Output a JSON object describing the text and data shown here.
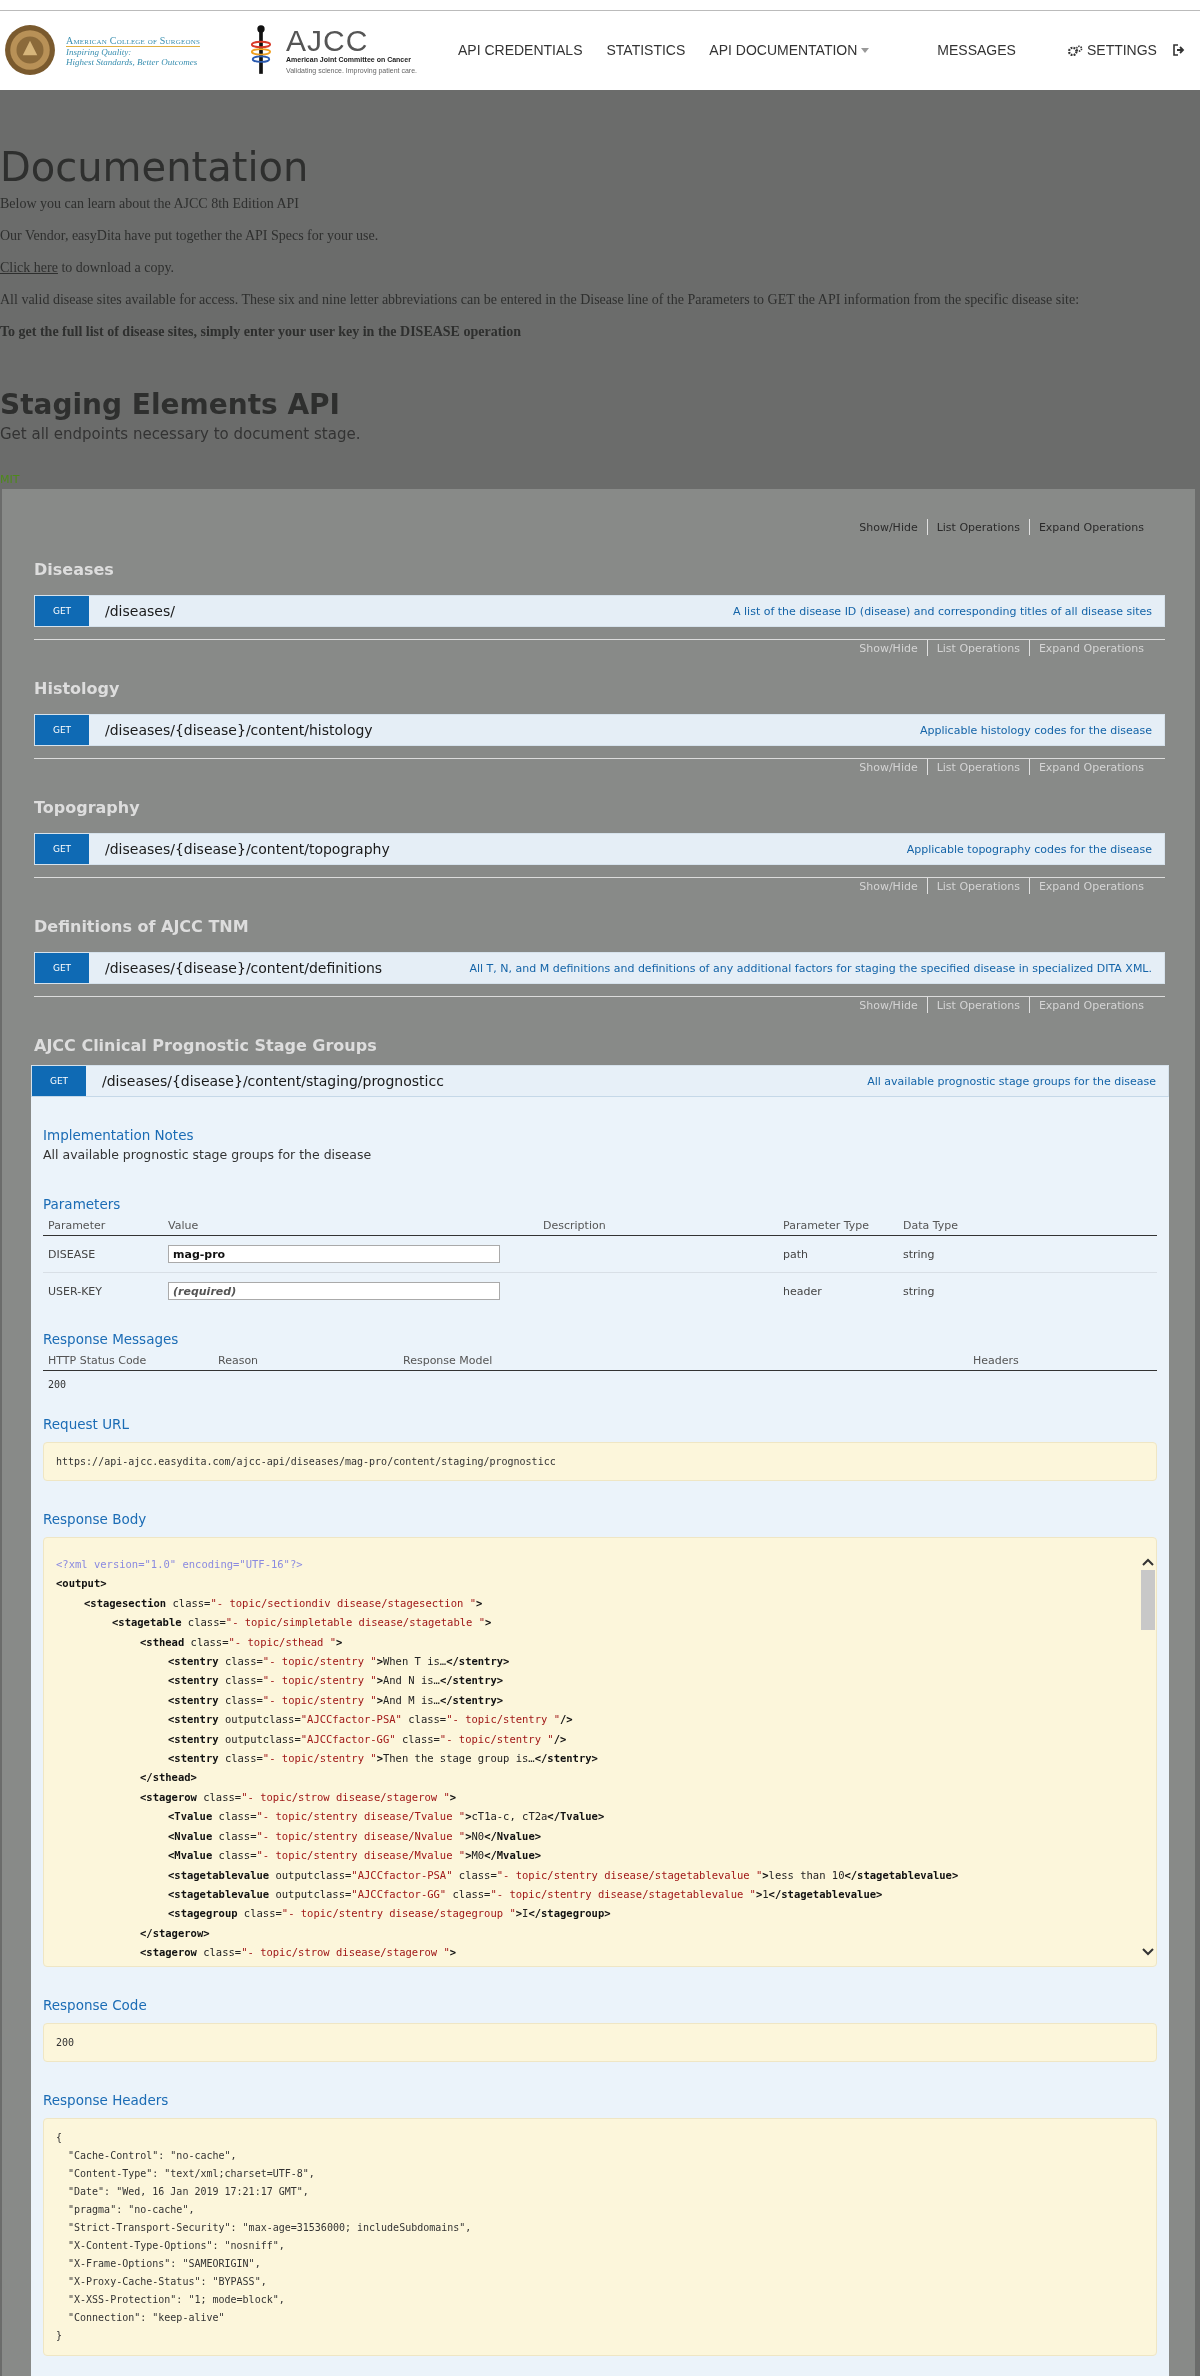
{
  "header": {
    "acs_logo": {
      "name": "American College of Surgeons",
      "tagline_1": "Inspiring Quality:",
      "tagline_2": "Highest Standards, Better Outcomes"
    },
    "ajcc_logo": {
      "name": "AJCC",
      "full_name": "American Joint Committee on Cancer",
      "tagline": "Validating science. Improving patient care."
    },
    "nav": [
      {
        "label": "API CREDENTIALS",
        "kind": "link"
      },
      {
        "label": "STATISTICS",
        "kind": "link"
      },
      {
        "label": "API DOCUMENTATION",
        "kind": "dropdown"
      },
      {
        "label": "MESSAGES",
        "kind": "link"
      },
      {
        "label": "SETTINGS",
        "kind": "settings"
      },
      {
        "kind": "logout"
      }
    ]
  },
  "intro": {
    "title": "Documentation",
    "line_1": "Below you can learn about the AJCC 8th Edition API",
    "line_2": "Our Vendor, easyDita have put together the API Specs for your use.",
    "download_link": "Click here",
    "download_rest": "to download a copy.",
    "line_4": "All valid disease sites available for access. These six and nine letter abbreviations can be entered in the Disease line of the Parameters to GET the API information from the specific disease site:",
    "line_5": "To get the full list of disease sites, simply enter your user key in the DISEASE operation"
  },
  "api": {
    "title": "Staging Elements API",
    "subtitle": "Get all endpoints necessary to document stage.",
    "license": "MIT"
  },
  "sections": [
    {
      "title": "Diseases",
      "links": [
        "Show/Hide",
        "List Operations",
        "Expand Operations"
      ],
      "active": true,
      "method": "GET",
      "path": "/diseases/",
      "summary": "A list of the disease ID (disease) and corresponding titles of all disease sites",
      "expanded": false
    },
    {
      "title": "Histology",
      "links": [
        "Show/Hide",
        "List Operations",
        "Expand Operations"
      ],
      "active": false,
      "method": "GET",
      "path": "/diseases/{disease}/content/histology",
      "summary": "Applicable histology codes for the disease",
      "expanded": false
    },
    {
      "title": "Topography",
      "links": [
        "Show/Hide",
        "List Operations",
        "Expand Operations"
      ],
      "active": false,
      "method": "GET",
      "path": "/diseases/{disease}/content/topography",
      "summary": "Applicable topography codes for the disease",
      "expanded": false
    },
    {
      "title": "Definitions of AJCC TNM",
      "links": [
        "Show/Hide",
        "List Operations",
        "Expand Operations"
      ],
      "active": false,
      "method": "GET",
      "path": "/diseases/{disease}/content/definitions",
      "summary": "All T, N, and M definitions and definitions of any additional factors for staging the specified disease in specialized DITA XML.",
      "expanded": false
    },
    {
      "title": "AJCC Clinical Prognostic Stage Groups",
      "links": [
        "Show/Hide",
        "List Operations",
        "Expand Operations"
      ],
      "active": false,
      "method": "GET",
      "path": "/diseases/{disease}/content/staging/prognosticc",
      "summary": "All available prognostic stage groups for the disease",
      "expanded": true
    }
  ],
  "details": {
    "notes_title": "Implementation Notes",
    "notes": "All available prognostic stage groups for the disease",
    "params_title": "Parameters",
    "param_columns": [
      "Parameter",
      "Value",
      "Description",
      "Parameter Type",
      "Data Type"
    ],
    "params": [
      {
        "name": "DISEASE",
        "value": "mag-pro",
        "param_type": "path",
        "data_type": "string"
      },
      {
        "name": "USER-KEY",
        "placeholder": "(required)",
        "param_type": "header",
        "data_type": "string"
      }
    ],
    "messages_title": "Response Messages",
    "message_columns": [
      "HTTP Status Code",
      "Reason",
      "Response Model",
      "Headers"
    ],
    "messages": [
      {
        "code": "200"
      }
    ],
    "request_url_title": "Request URL",
    "request_url": "https://api-ajcc.easydita.com/ajcc-api/diseases/mag-pro/content/staging/prognosticc",
    "body_title": "Response Body",
    "body": [
      {
        "kind": "declaration",
        "text": "<?xml version=\"1.0\" encoding=\"UTF-16\"?>"
      },
      {
        "kind": "tag",
        "text": "<output>",
        "children": [
          {
            "text": "<stagesection class=\"- topic/sectiondiv disease/stagesection \">",
            "children": [
              {
                "text": "<stagetable class=\"- topic/simpletable disease/stagetable \">",
                "children": [
                  {
                    "text": "<sthead class=\"- topic/sthead \">",
                    "children": [
                      {
                        "text": "<stentry class=\"- topic/stentry \">When T is…</stentry>"
                      },
                      {
                        "text": "<stentry class=\"- topic/stentry \">And N is…</stentry>"
                      },
                      {
                        "text": "<stentry class=\"- topic/stentry \">And M is…</stentry>"
                      },
                      {
                        "text": "<stentry outputclass=\"AJCCfactor-PSA\" class=\"- topic/stentry \"/>"
                      },
                      {
                        "text": "<stentry outputclass=\"AJCCfactor-GG\" class=\"- topic/stentry \"/>"
                      },
                      {
                        "text": "<stentry class=\"- topic/stentry \">Then the stage group is…</stentry>"
                      }
                    ]
                  },
                  {
                    "text": "</sthead>"
                  },
                  {
                    "text": "<stagerow class=\"- topic/strow disease/stagerow \">",
                    "children": [
                      {
                        "text": "<Tvalue class=\"- topic/stentry disease/Tvalue \">cT1a-c, cT2a</Tvalue>"
                      },
                      {
                        "text": "<Nvalue class=\"- topic/stentry disease/Nvalue \">N0</Nvalue>"
                      },
                      {
                        "text": "<Mvalue class=\"- topic/stentry disease/Mvalue \">M0</Mvalue>"
                      },
                      {
                        "text": "<stagetablevalue outputclass=\"AJCCfactor-PSA\" class=\"- topic/stentry disease/stagetablevalue \">less than 10</stagetablevalue>"
                      },
                      {
                        "text": "<stagetablevalue outputclass=\"AJCCfactor-GG\" class=\"- topic/stentry disease/stagetablevalue \">1</stagetablevalue>"
                      },
                      {
                        "text": "<stagegroup class=\"- topic/stentry disease/stagegroup \">I</stagegroup>"
                      }
                    ]
                  },
                  {
                    "text": "</stagerow>"
                  },
                  {
                    "text": "<stagerow class=\"- topic/strow disease/stagerow \">"
                  }
                ]
              }
            ]
          }
        ]
      }
    ],
    "code_title": "Response Code",
    "code": "200",
    "headers_title": "Response Headers",
    "headers_open": "{",
    "headers": [
      "\"Cache-Control\": \"no-cache\",",
      "\"Content-Type\": \"text/xml;charset=UTF-8\",",
      "\"Date\": \"Wed, 16 Jan 2019 17:21:17 GMT\",",
      "\"pragma\": \"no-cache\",",
      "\"Strict-Transport-Security\": \"max-age=31536000; includeSubdomains\",",
      "\"X-Content-Type-Options\": \"nosniff\",",
      "\"X-Frame-Options\": \"SAMEORIGIN\",",
      "\"X-Proxy-Cache-Status\": \"BYPASS\",",
      "\"X-XSS-Protection\": \"1; mode=block\",",
      "\"Connection\": \"keep-alive\""
    ],
    "headers_close": "}"
  }
}
